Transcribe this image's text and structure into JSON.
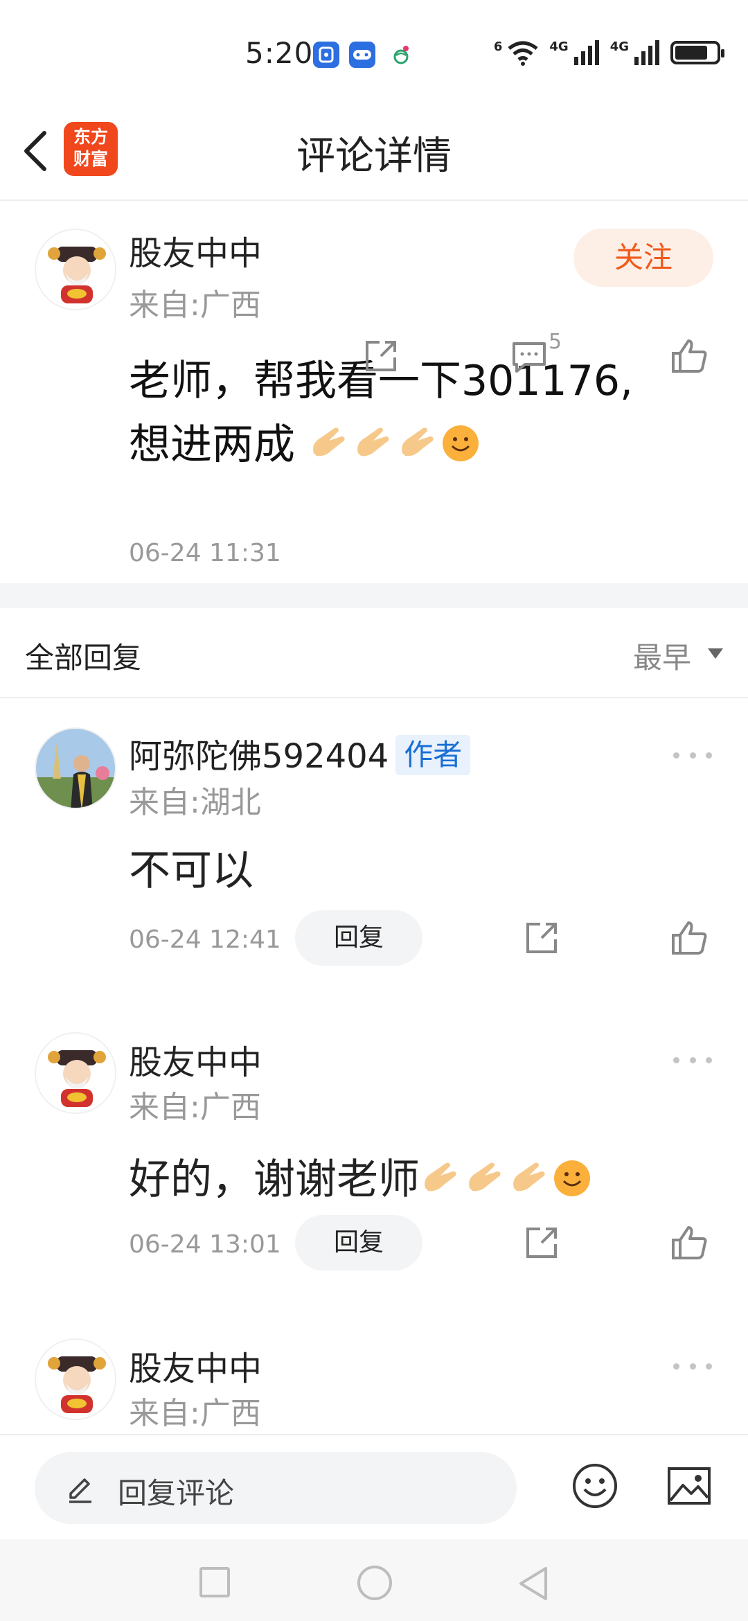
{
  "status_bar": {
    "time": "5:20",
    "network_1": "6",
    "network_2": "4G",
    "network_3": "4G",
    "icons": [
      "app-icon-blue",
      "game-icon",
      "mobile-icon",
      "wifi-icon",
      "signal-icon",
      "signal-icon",
      "battery-icon"
    ],
    "battery_level": 0.72
  },
  "header": {
    "logo_line1": "东方",
    "logo_line2": "财富",
    "title": "评论详情"
  },
  "main_comment": {
    "username": "股友中中",
    "location": "来自:广西",
    "follow_label": "关注",
    "text_line1": "老师，帮我看一下301176,",
    "text_line2": "想进两成",
    "time": "06-24 11:31",
    "reply_count": "5",
    "colors": {
      "accent": "#f05a1a",
      "follow_bg": "#fdeee6"
    }
  },
  "replies_header": {
    "title": "全部回复",
    "sort": "最早"
  },
  "replies": [
    {
      "username": "阿弥陀佛592404",
      "tag": "作者",
      "location": "来自:湖北",
      "text": "不可以",
      "time": "06-24 12:41",
      "reply_label": "回复"
    },
    {
      "username": "股友中中",
      "location": "来自:广西",
      "text": "好的，谢谢老师",
      "time": "06-24 13:01",
      "reply_label": "回复"
    },
    {
      "username": "股友中中",
      "location": "来自:广西"
    }
  ],
  "bottom_bar": {
    "placeholder": "回复评论"
  }
}
